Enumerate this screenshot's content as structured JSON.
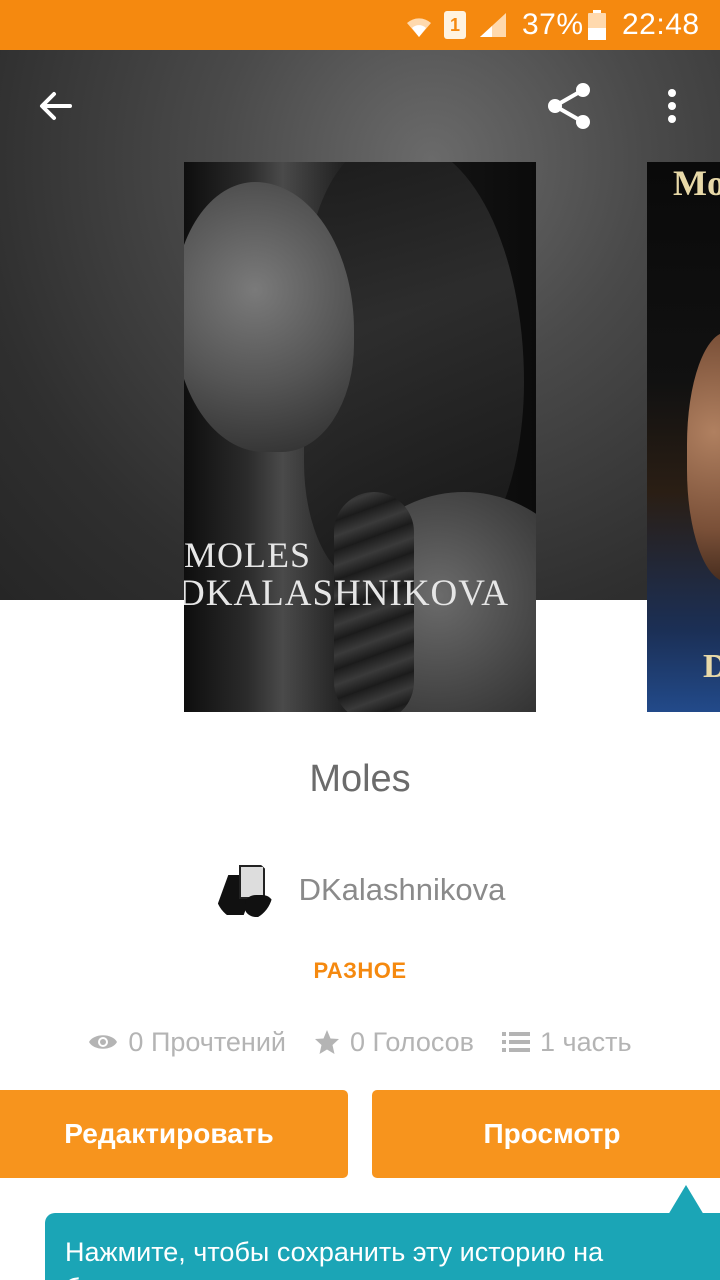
{
  "status_bar": {
    "battery_percent": "37%",
    "time": "22:48",
    "sim_label": "1",
    "icons": [
      "wifi-icon",
      "sim-icon",
      "signal-icon",
      "battery-icon"
    ]
  },
  "header": {
    "back_icon": "arrow-left-icon",
    "share_icon": "share-icon",
    "more_icon": "more-vertical-icon"
  },
  "cover": {
    "title_text": "MOLES",
    "author_text": "DKALASHNIKOVA",
    "next_cover_title": "Mo",
    "next_cover_letter": "D"
  },
  "story": {
    "title": "Moles",
    "author": "DKalashnikova",
    "category": "РАЗНОЕ"
  },
  "stats": {
    "reads": "0 Прочтений",
    "votes": "0 Голосов",
    "parts": "1 часть"
  },
  "actions": {
    "edit_label": "Редактировать",
    "view_label": "Просмотр"
  },
  "tooltip": {
    "text_line1": "Нажмите, чтобы сохранить эту историю на",
    "text_line2": "б"
  },
  "colors": {
    "accent": "#f5890f",
    "button": "#f7941d",
    "tooltip": "#1ba5b6"
  }
}
